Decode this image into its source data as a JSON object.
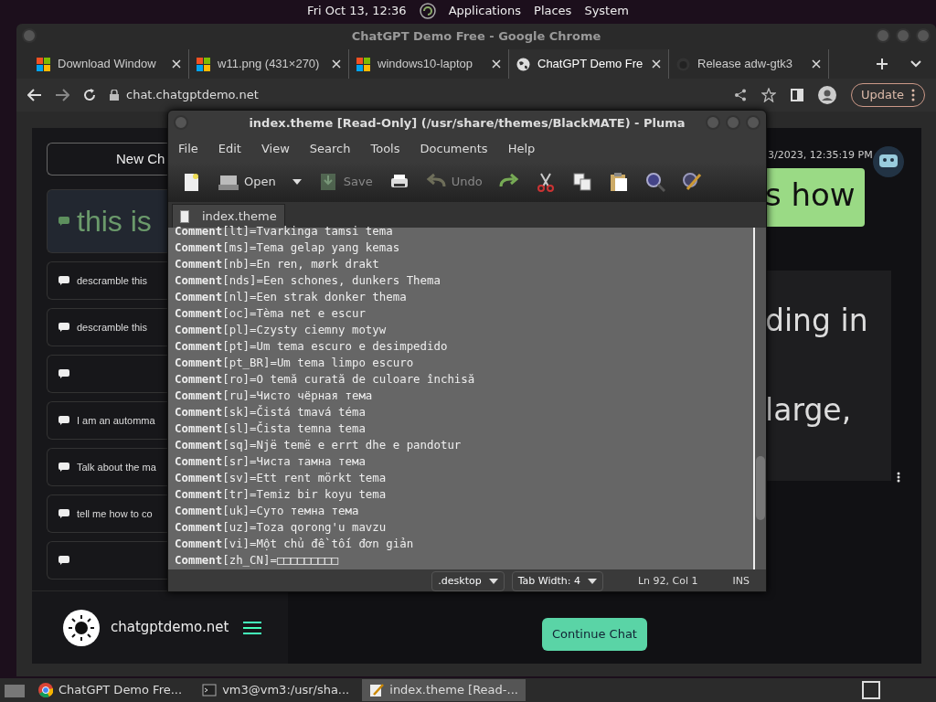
{
  "top_panel": {
    "clock": "Fri Oct 13, 12:36",
    "menus": [
      "Applications",
      "Places",
      "System"
    ]
  },
  "chrome": {
    "title": "ChatGPT Demo Free - Google Chrome",
    "tabs": [
      {
        "label": "Download Window",
        "kind": "windows",
        "selected": false
      },
      {
        "label": "w11.png (431×270)",
        "kind": "windows",
        "selected": false
      },
      {
        "label": "windows10-laptop",
        "kind": "windows",
        "selected": false
      },
      {
        "label": "ChatGPT Demo Fre",
        "kind": "web",
        "selected": true
      },
      {
        "label": "Release adw-gtk3",
        "kind": "repo",
        "selected": false
      }
    ],
    "url": "chat.chatgptdemo.net",
    "update_label": "Update",
    "page": {
      "new_chat": "New Ch",
      "chats": [
        {
          "text": "this is",
          "selected": true
        },
        {
          "text": "descramble this",
          "selected": false
        },
        {
          "text": "descramble this",
          "selected": false
        },
        {
          "selected": false
        },
        {
          "text": "I am an automma",
          "selected": false
        },
        {
          "text": "Talk about the ma",
          "selected": false
        },
        {
          "text": "tell me how to co",
          "selected": false
        },
        {
          "selected": false
        }
      ],
      "site_name": "chatgptdemo.net",
      "timestamp": "3/2023, 12:35:19 PM",
      "user_message": "s how",
      "reply_lines": [
        "ding in",
        "large,"
      ],
      "continue_button": "Continue Chat"
    }
  },
  "pluma": {
    "title": "index.theme [Read-Only] (/usr/share/themes/BlackMATE) - Pluma",
    "menus": [
      "File",
      "Edit",
      "View",
      "Search",
      "Tools",
      "Documents",
      "Help"
    ],
    "toolbar": [
      {
        "kind": "new",
        "disabled": false
      },
      {
        "kind": "open",
        "label": "Open",
        "disabled": false
      },
      {
        "kind": "save",
        "label": "Save",
        "disabled": true
      },
      {
        "kind": "print",
        "disabled": false
      },
      {
        "kind": "undo",
        "label": "Undo",
        "disabled": true
      },
      {
        "kind": "redo",
        "disabled": false
      },
      {
        "kind": "cut",
        "disabled": false
      },
      {
        "kind": "copy",
        "disabled": false
      },
      {
        "kind": "paste",
        "disabled": false
      },
      {
        "kind": "find",
        "disabled": false
      },
      {
        "kind": "replace",
        "disabled": false
      }
    ],
    "tab": "index.theme",
    "lines": [
      "**Comment**[lt]=Tvarkinga tamsi tema",
      "**Comment**[ms]=Tema gelap yang kemas",
      "**Comment**[nb]=En ren, mørk drakt",
      "**Comment**[nds]=Een schones, dunkers Thema",
      "**Comment**[nl]=Een strak donker thema",
      "**Comment**[oc]=Tèma net e escur",
      "**Comment**[pl]=Czysty ciemny motyw",
      "**Comment**[pt]=Um tema escuro e desimpedido",
      "**Comment**[pt_BR]=Um tema limpo escuro",
      "**Comment**[ro]=O temă curată de culoare închisă",
      "**Comment**[ru]=Чисто чёрная тема",
      "**Comment**[sk]=Čistá tmavá téma",
      "**Comment**[sl]=Čista temna tema",
      "**Comment**[sq]=Një temë e errt dhe e pandotur",
      "**Comment**[sr]=Чиста тамна тема",
      "**Comment**[sv]=Ett rent mörkt tema",
      "**Comment**[tr]=Temiz bir koyu tema",
      "**Comment**[uk]=Суто темна тема",
      "**Comment**[uz]=Toza qorong'u mavzu",
      "**Comment**[vi]=Một chủ đề tối đơn giản",
      "**Comment**[zh_CN]=□□□□□□□□□"
    ],
    "status": {
      "language": ".desktop",
      "tab_width": "Tab Width:  4",
      "position": "Ln 92, Col 1",
      "mode": "INS"
    }
  },
  "taskbar": [
    {
      "label": "ChatGPT Demo Fre...",
      "kind": "browser",
      "selected": false
    },
    {
      "label": "vm3@vm3:/usr/sha...",
      "kind": "terminal",
      "selected": false
    },
    {
      "label": "index.theme [Read-...",
      "kind": "editor",
      "selected": true
    }
  ]
}
